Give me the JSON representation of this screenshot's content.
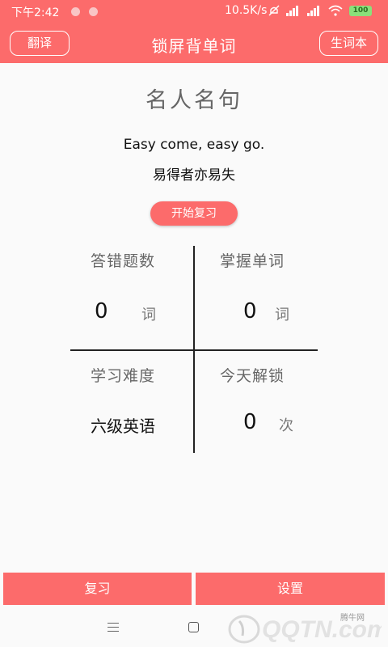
{
  "status_bar": {
    "time": "下午2:42",
    "net_speed": "10.5K/s",
    "battery": "100"
  },
  "app_bar": {
    "title": "锁屏背单词",
    "translate_label": "翻译",
    "vocab_label": "生词本"
  },
  "quote": {
    "title": "名人名句",
    "english": "Easy come, easy go.",
    "chinese": "易得者亦易失"
  },
  "review_start_label": "开始复习",
  "stats": {
    "wrong": {
      "label": "答错题数",
      "value": "0",
      "unit": "词"
    },
    "mastered": {
      "label": "掌握单词",
      "value": "0",
      "unit": "词"
    },
    "difficulty": {
      "label": "学习难度",
      "value": "六级英语"
    },
    "unlock": {
      "label": "今天解锁",
      "value": "0",
      "unit": "次"
    }
  },
  "bottom": {
    "review_label": "复习",
    "settings_label": "设置"
  },
  "watermark": {
    "site_name": "腾牛网",
    "logo_text": "QQTN.com"
  },
  "colors": {
    "accent": "#fc6b6b"
  }
}
